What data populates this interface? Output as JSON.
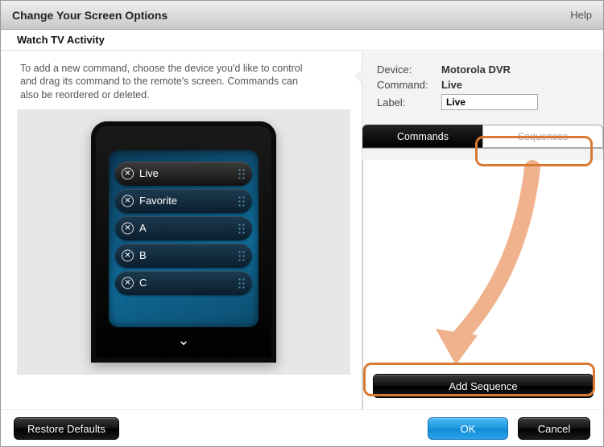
{
  "window": {
    "title": "Change Your Screen Options",
    "help": "Help",
    "subtitle": "Watch TV Activity"
  },
  "instructions": "To add a new command, choose the device you'd like to control and drag its command to the remote's screen. Commands can also be reordered or deleted.",
  "remote": {
    "items": [
      "Live",
      "Favorite",
      "A",
      "B",
      "C"
    ],
    "selected_index": 0,
    "chevron": "⌄"
  },
  "details": {
    "device_label": "Device:",
    "device_value": "Motorola DVR",
    "command_label": "Command:",
    "command_value": "Live",
    "label_label": "Label:",
    "label_value": "Live"
  },
  "tabs": {
    "commands": "Commands",
    "sequences": "Sequences"
  },
  "buttons": {
    "add_sequence": "Add Sequence",
    "restore": "Restore Defaults",
    "ok": "OK",
    "cancel": "Cancel"
  }
}
